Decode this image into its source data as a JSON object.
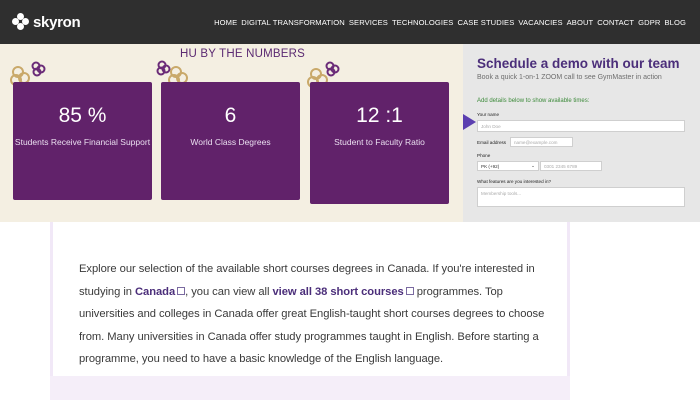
{
  "brand": {
    "name": "skyron"
  },
  "nav": {
    "items": [
      "HOME",
      "DIGITAL TRANSFORMATION",
      "SERVICES",
      "TECHNOLOGIES",
      "CASE STUDIES",
      "VACANCIES",
      "ABOUT",
      "CONTACT",
      "GDPR",
      "BLOG"
    ]
  },
  "stats": {
    "title": "HU BY THE NUMBERS",
    "cards": [
      {
        "value": "85 %",
        "label": "Students Receive Financial Support"
      },
      {
        "value": "6",
        "label": "World Class Degrees"
      },
      {
        "value": "12 :1",
        "label": "Student to Faculty Ratio"
      }
    ]
  },
  "demo": {
    "title": "Schedule a demo with our team",
    "subtitle": "Book a quick 1-on-1 ZOOM call to see GymMaster in action",
    "hint": "Add details below to show available times:",
    "fields": {
      "name_label": "Your name",
      "name_placeholder": "John Doe",
      "email_label": "Email address",
      "email_placeholder": "name@example.com",
      "phone_label": "Phone",
      "phone_country": "PK (+92)",
      "phone_placeholder": "0301 2345 6789",
      "features_label": "What features are you interested in?",
      "features_placeholder": "Membership tools..."
    }
  },
  "content": {
    "text_1": "Explore our selection of the available short courses degrees in Canada. If you're interested in studying in ",
    "link_canada": "Canada",
    "text_2": ", you can view all ",
    "link_courses": "view all 38 short courses",
    "text_3": " programmes. Top universities and colleges in Canada offer great English-taught short courses degrees to choose from. Many universities in Canada offer study programmes taught in English. Before starting a programme, you need to have a basic knowledge of the English language."
  },
  "colors": {
    "nav_bg": "#2f2f2f",
    "stats_bg": "#f4efe2",
    "card_purple": "#61226a",
    "demo_title": "#4b2e7a",
    "hint_green": "#3c8a3a"
  }
}
